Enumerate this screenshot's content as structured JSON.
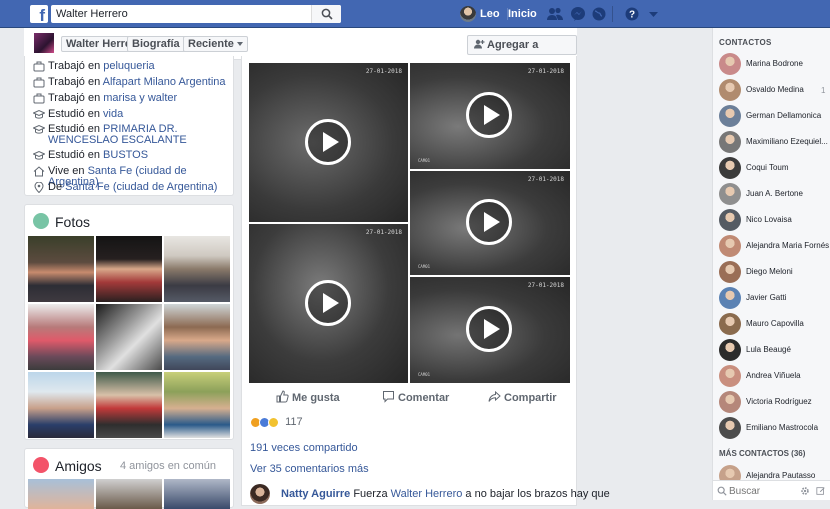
{
  "topbar": {
    "logo_letter": "f",
    "search_value": "Walter Herrero",
    "user_name": "Leo",
    "home_label": "Inicio"
  },
  "subheader": {
    "name": "Walter Herrero",
    "tab_timeline": "Biografía",
    "tab_recent": "Reciente",
    "add_friend": "Agregar a amigos"
  },
  "intro": {
    "items": [
      {
        "prefix": "Trabajó en ",
        "link": "peluqueria"
      },
      {
        "prefix": "Trabajó en ",
        "link": "Alfapart Milano Argentina"
      },
      {
        "prefix": "Trabajó en ",
        "link": "marisa y walter"
      },
      {
        "prefix": "Estudió en ",
        "link": "vida"
      },
      {
        "prefix": "Estudió en ",
        "link": "PRIMARIA DR. WENCESLAO ESCALANTE"
      },
      {
        "prefix": "Estudió en ",
        "link": "BUSTOS"
      },
      {
        "prefix": "Vive en ",
        "link": "Santa Fe (ciudad de Argentina)"
      },
      {
        "prefix": "De ",
        "link": "Santa Fe (ciudad de Argentina)"
      }
    ]
  },
  "photos": {
    "title": "Fotos"
  },
  "friends": {
    "title": "Amigos",
    "subtitle": "4 amigos en común"
  },
  "post": {
    "video_timestamps": [
      "27-01-2018",
      "27-01-2018",
      "27-01-2018",
      "27-01-2018",
      "27-01-2018",
      "27-01-2018"
    ],
    "cam_label": "CAM01",
    "like": "Me gusta",
    "comment": "Comentar",
    "share": "Compartir",
    "reactions_count": "117",
    "shared": "191 veces compartido",
    "more_comments": "Ver 35 comentarios más",
    "comment_author": "Natty Aguirre",
    "comment_pre": " Fuerza ",
    "comment_mention": "Walter Herrero",
    "comment_post": " a no bajar los brazos hay que"
  },
  "chat": {
    "header": "CONTACTOS",
    "contacts": [
      {
        "name": "Marina Bodrone",
        "color": "#c98a8a"
      },
      {
        "name": "Osvaldo Medina",
        "color": "#b08b6e"
      },
      {
        "name": "German Dellamonica",
        "color": "#6b7f99"
      },
      {
        "name": "Maximiliano Ezequiel...",
        "color": "#777777"
      },
      {
        "name": "Coqui Toum",
        "color": "#3b3b3b"
      },
      {
        "name": "Juan A. Bertone",
        "color": "#8f8f8f"
      },
      {
        "name": "Nico Lovaisa",
        "color": "#555b63"
      },
      {
        "name": "Alejandra Maria Fornés",
        "color": "#c08a74"
      },
      {
        "name": "Diego Meloni",
        "color": "#9a6e56"
      },
      {
        "name": "Javier Gatti",
        "color": "#5b82b3"
      },
      {
        "name": "Mauro Capovilla",
        "color": "#8a6b4e"
      },
      {
        "name": "Lula Beaugé",
        "color": "#2b2b2b"
      },
      {
        "name": "Andrea Viñuela",
        "color": "#c98f7f"
      },
      {
        "name": "Victoria Rodríguez",
        "color": "#b5877a"
      },
      {
        "name": "Emiliano Mastrocola",
        "color": "#4c4c4c"
      }
    ],
    "more_contacts": "MÁS CONTACTOS (36)",
    "extra_contact": "Alejandra Pautasso",
    "extra_color": "#c6a18a",
    "search_placeholder": "Buscar",
    "side_number": "1"
  }
}
